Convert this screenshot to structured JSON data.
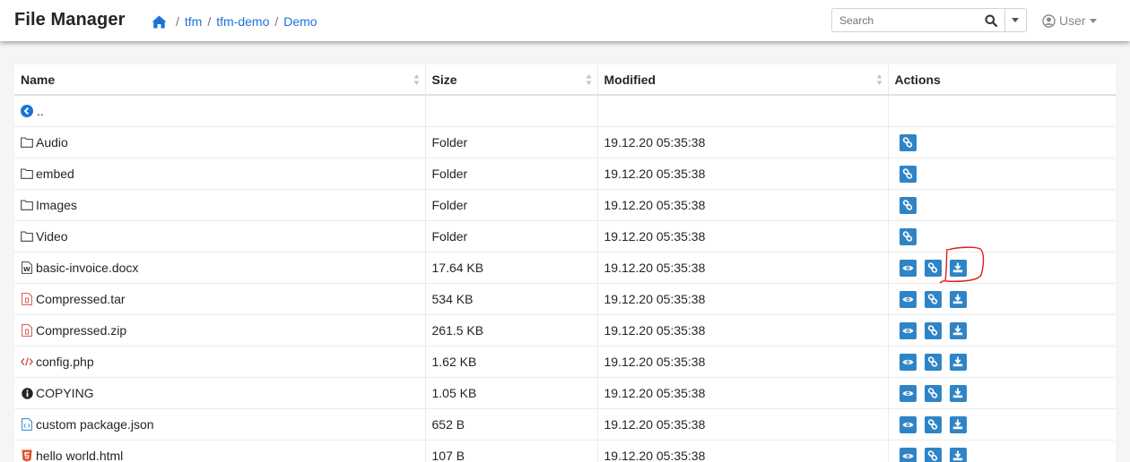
{
  "app": {
    "title": "File Manager"
  },
  "breadcrumb": {
    "items": [
      "tfm",
      "tfm-demo",
      "Demo"
    ],
    "separator": "/"
  },
  "search": {
    "placeholder": "Search",
    "value": ""
  },
  "user": {
    "label": "User"
  },
  "table": {
    "columns": {
      "name": "Name",
      "size": "Size",
      "modified": "Modified",
      "actions": "Actions"
    },
    "parent_link": "..",
    "rows": [
      {
        "name": "Audio",
        "size": "Folder",
        "modified": "19.12.20 05:35:38",
        "icon": "folder-icon",
        "actions": [
          "link"
        ]
      },
      {
        "name": "embed",
        "size": "Folder",
        "modified": "19.12.20 05:35:38",
        "icon": "folder-icon",
        "actions": [
          "link"
        ]
      },
      {
        "name": "Images",
        "size": "Folder",
        "modified": "19.12.20 05:35:38",
        "icon": "folder-icon",
        "actions": [
          "link"
        ]
      },
      {
        "name": "Video",
        "size": "Folder",
        "modified": "19.12.20 05:35:38",
        "icon": "folder-icon",
        "actions": [
          "link"
        ]
      },
      {
        "name": "basic-invoice.docx",
        "size": "17.64 KB",
        "modified": "19.12.20 05:35:38",
        "icon": "word-file-icon",
        "actions": [
          "view",
          "link",
          "download"
        ]
      },
      {
        "name": "Compressed.tar",
        "size": "534 KB",
        "modified": "19.12.20 05:35:38",
        "icon": "archive-file-icon",
        "actions": [
          "view",
          "link",
          "download"
        ]
      },
      {
        "name": "Compressed.zip",
        "size": "261.5 KB",
        "modified": "19.12.20 05:35:38",
        "icon": "archive-file-icon",
        "actions": [
          "view",
          "link",
          "download"
        ]
      },
      {
        "name": "config.php",
        "size": "1.62 KB",
        "modified": "19.12.20 05:35:38",
        "icon": "code-icon",
        "actions": [
          "view",
          "link",
          "download"
        ]
      },
      {
        "name": "COPYING",
        "size": "1.05 KB",
        "modified": "19.12.20 05:35:38",
        "icon": "info-icon",
        "actions": [
          "view",
          "link",
          "download"
        ]
      },
      {
        "name": "custom package.json",
        "size": "652 B",
        "modified": "19.12.20 05:35:38",
        "icon": "code-file-icon",
        "actions": [
          "view",
          "link",
          "download"
        ]
      },
      {
        "name": "hello world.html",
        "size": "107 B",
        "modified": "19.12.20 05:35:38",
        "icon": "html5-icon",
        "actions": [
          "view",
          "link",
          "download"
        ]
      }
    ]
  },
  "colors": {
    "accent": "#2f84c6",
    "link": "#1a73d9",
    "annotation": "#e01b1b"
  }
}
